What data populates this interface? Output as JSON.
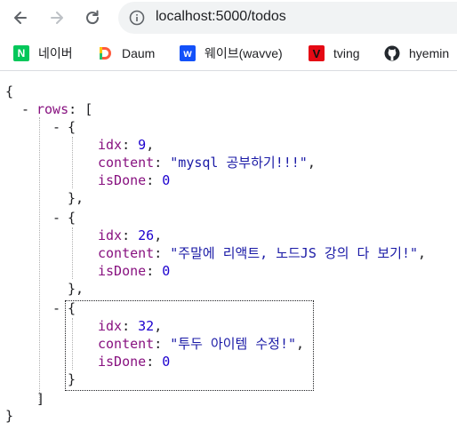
{
  "browser": {
    "url": "localhost:5000/todos",
    "bookmarks": [
      {
        "label": "네이버",
        "icon": "naver-icon",
        "color": "#03c75a",
        "glyph": "N"
      },
      {
        "label": "Daum",
        "icon": "daum-icon",
        "color": "#ff5a3c",
        "glyph": "D"
      },
      {
        "label": "웨이브(wavve)",
        "icon": "wavve-icon",
        "color": "#1351f9",
        "glyph": "w"
      },
      {
        "label": "tving",
        "icon": "tving-icon",
        "color": "#e50914",
        "glyph": "V"
      },
      {
        "label": "hyemin",
        "icon": "github-icon",
        "color": "#24292e",
        "glyph": ""
      }
    ]
  },
  "json_view": {
    "open_brace": "{",
    "close_brace": "}",
    "collapse_glyph": "-",
    "rows_key": "rows",
    "colon": ":",
    "open_bracket": "[",
    "close_bracket": "]",
    "item_open": "{",
    "item_close": "},",
    "item_close_last": "}",
    "comma": ",",
    "field_keys": {
      "idx": "idx",
      "content": "content",
      "isDone": "isDone"
    },
    "items": [
      {
        "idx": "9",
        "content": "\"mysql 공부하기!!!\"",
        "isDone": "0"
      },
      {
        "idx": "26",
        "content": "\"주말에 리액트, 노드JS 강의 다 보기!\"",
        "isDone": "0"
      },
      {
        "idx": "32",
        "content": "\"투두 아이템 수정!\"",
        "isDone": "0"
      }
    ]
  }
}
